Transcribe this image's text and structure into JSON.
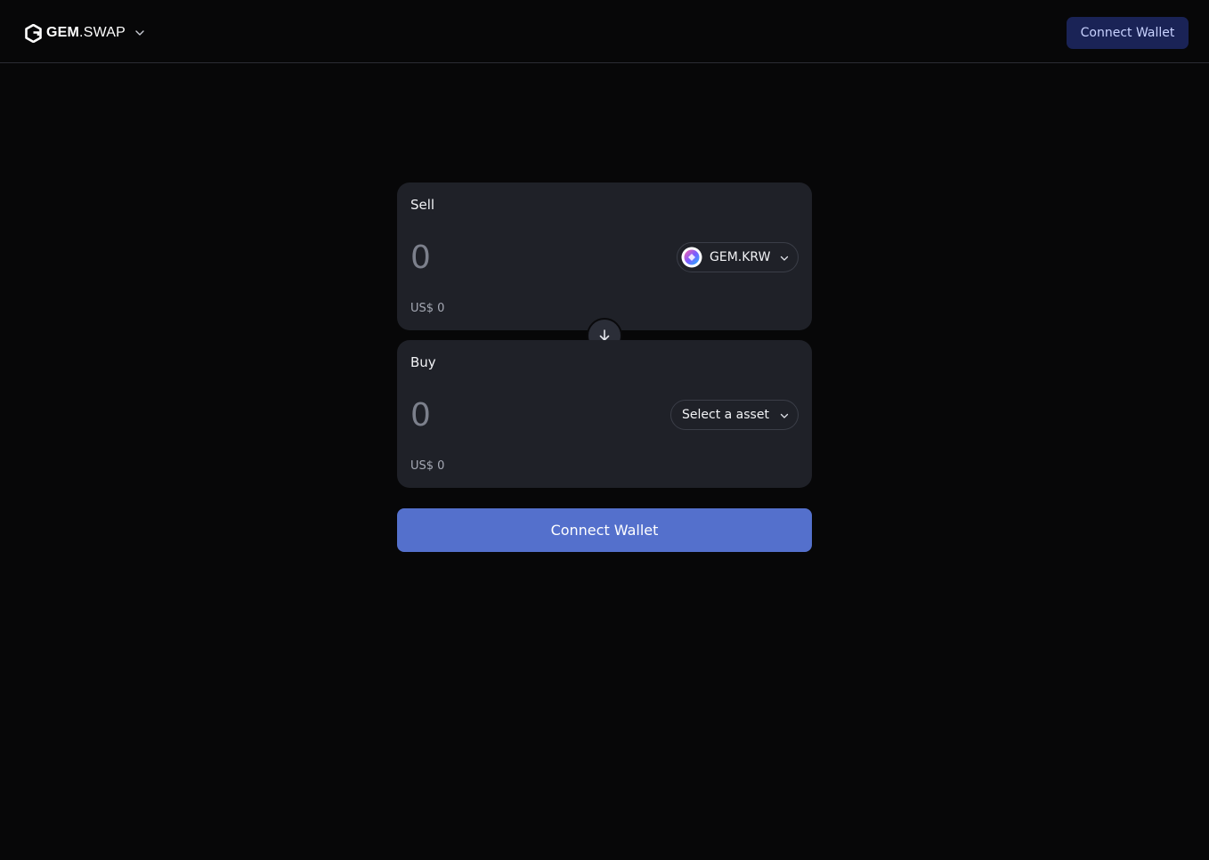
{
  "header": {
    "brand": {
      "bold": "GEM",
      "light": ".SWAP"
    },
    "connect_label": "Connect Wallet"
  },
  "swap": {
    "sell": {
      "label": "Sell",
      "amount_placeholder": "0",
      "usd_value": "US$ 0",
      "token": {
        "symbol": "GEM.KRW",
        "icon": "gem-krw-token-icon"
      }
    },
    "buy": {
      "label": "Buy",
      "amount_placeholder": "0",
      "usd_value": "US$ 0",
      "token": {
        "placeholder": "Select a asset"
      }
    },
    "flip_icon": "arrow-down-icon",
    "connect_label": "Connect Wallet"
  },
  "colors": {
    "background": "#070708",
    "panel": "#1f2128",
    "primary_button": "#5470cc",
    "header_button": "#1a2356"
  }
}
